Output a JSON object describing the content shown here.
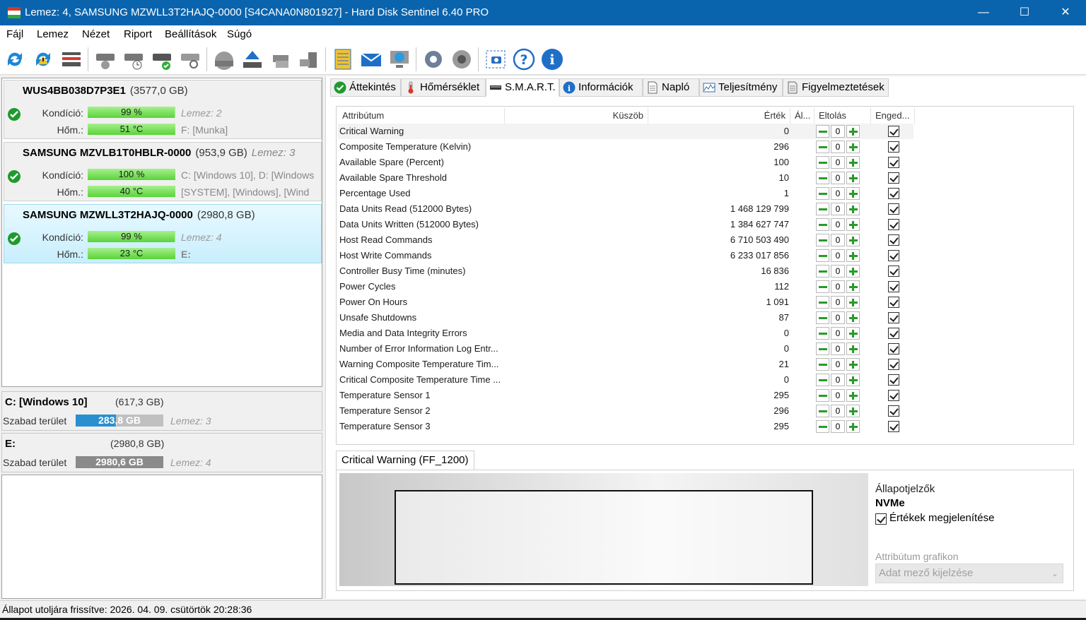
{
  "window": {
    "title": "Lemez: 4, SAMSUNG MZWLL3T2HAJQ-0000 [S4CANA0N801927]  -  Hard Disk Sentinel 6.40 PRO",
    "minimize": "—",
    "maximize": "☐",
    "close": "✕"
  },
  "menu": [
    "Fájl",
    "Lemez",
    "Nézet",
    "Riport",
    "Beállítások",
    "Súgó"
  ],
  "toolbar_icons": [
    "refresh-icon",
    "refresh-warning-icon",
    "disk-list-icon",
    "disk-settings-icon",
    "disk-clock-icon",
    "disk-check-icon",
    "disk-search-icon",
    "disk-gray-icon",
    "eject-icon",
    "disk-copy-icon",
    "disk-export-icon",
    "report-icon",
    "mail-icon",
    "network-icon",
    "settings-icon",
    "sound-icon",
    "screenshot-icon",
    "help-icon",
    "info-icon"
  ],
  "disks": [
    {
      "name": "WUS4BB038D7P3E1",
      "size": "(3577,0 GB)",
      "number": "",
      "health_label": "Kondíció:",
      "health": "99 %",
      "health_pct": 99,
      "temp_label": "Hőm.:",
      "temp": "51 °C",
      "temp_pct": 100,
      "side1": "Lemez: 2",
      "side2": "F: [Munka]"
    },
    {
      "name": "SAMSUNG MZVLB1T0HBLR-0000",
      "size": "(953,9 GB)",
      "number": "Lemez: 3",
      "health_label": "Kondíció:",
      "health": "100 %",
      "health_pct": 100,
      "temp_label": "Hőm.:",
      "temp": "40 °C",
      "temp_pct": 100,
      "side1": "C: [Windows 10], D: [Windows",
      "side2": "[SYSTEM],  [Windows],  [Wind"
    },
    {
      "name": "SAMSUNG MZWLL3T2HAJQ-0000",
      "size": "(2980,8 GB)",
      "number": "",
      "health_label": "Kondíció:",
      "health": "99 %",
      "health_pct": 99,
      "temp_label": "Hőm.:",
      "temp": "23 °C",
      "temp_pct": 100,
      "side1": "Lemez: 4",
      "side2": "E:"
    }
  ],
  "volumes": [
    {
      "name": "C: [Windows 10]",
      "size": "(617,3 GB)",
      "free_label": "Szabad terület",
      "free": "283,8 GB",
      "free_pct": 46,
      "color": "#2a8fd0",
      "disk": "Lemez: 3"
    },
    {
      "name": "E:",
      "size": "(2980,8 GB)",
      "free_label": "Szabad terület",
      "free": "2980,6 GB",
      "free_pct": 100,
      "color": "#8a8a8a",
      "disk": "Lemez: 4"
    }
  ],
  "tabs": [
    {
      "label": "Áttekintés",
      "icon": "check-icon"
    },
    {
      "label": "Hőmérséklet",
      "icon": "thermometer-icon"
    },
    {
      "label": "S.M.A.R.T.",
      "icon": "disk-icon"
    },
    {
      "label": "Információk",
      "icon": "info-icon"
    },
    {
      "label": "Napló",
      "icon": "log-icon"
    },
    {
      "label": "Teljesítmény",
      "icon": "performance-icon"
    },
    {
      "label": "Figyelmeztetések",
      "icon": "warnings-icon"
    }
  ],
  "smart": {
    "headers": [
      "Attribútum",
      "Küszöb",
      "Érték",
      "Ál...",
      "Eltolás",
      "Enged..."
    ],
    "rows": [
      {
        "name": "Critical Warning",
        "value": "0",
        "offset": "0"
      },
      {
        "name": "Composite Temperature (Kelvin)",
        "value": "296",
        "offset": "0"
      },
      {
        "name": "Available Spare (Percent)",
        "value": "100",
        "offset": "0"
      },
      {
        "name": "Available Spare Threshold",
        "value": "10",
        "offset": "0"
      },
      {
        "name": "Percentage Used",
        "value": "1",
        "offset": "0"
      },
      {
        "name": "Data Units Read (512000 Bytes)",
        "value": "1 468 129 799",
        "offset": "0"
      },
      {
        "name": "Data Units Written (512000 Bytes)",
        "value": "1 384 627 747",
        "offset": "0"
      },
      {
        "name": "Host Read Commands",
        "value": "6 710 503 490",
        "offset": "0"
      },
      {
        "name": "Host Write Commands",
        "value": "6 233 017 856",
        "offset": "0"
      },
      {
        "name": "Controller Busy Time (minutes)",
        "value": "16 836",
        "offset": "0"
      },
      {
        "name": "Power Cycles",
        "value": "112",
        "offset": "0"
      },
      {
        "name": "Power On Hours",
        "value": "1 091",
        "offset": "0"
      },
      {
        "name": "Unsafe Shutdowns",
        "value": "87",
        "offset": "0"
      },
      {
        "name": "Media and Data Integrity Errors",
        "value": "0",
        "offset": "0"
      },
      {
        "name": "Number of Error Information Log Entr...",
        "value": "0",
        "offset": "0"
      },
      {
        "name": "Warning Composite Temperature Tim...",
        "value": "21",
        "offset": "0"
      },
      {
        "name": "Critical Composite Temperature Time ...",
        "value": "0",
        "offset": "0"
      },
      {
        "name": "Temperature Sensor 1",
        "value": "295",
        "offset": "0"
      },
      {
        "name": "Temperature Sensor 2",
        "value": "296",
        "offset": "0"
      },
      {
        "name": "Temperature Sensor 3",
        "value": "295",
        "offset": "0"
      }
    ]
  },
  "detail": {
    "tab": "Critical Warning (FF_1200)",
    "status_label": "Állapotjelzők",
    "nvme": "NVMe",
    "show_values": "Értékek megjelenítése",
    "graph_label": "Attribútum grafikon",
    "select_placeholder": "Adat mező kijelzése"
  },
  "status": "Állapot utoljára frissítve: 2026. 04. 09. csütörtök 20:28:36"
}
